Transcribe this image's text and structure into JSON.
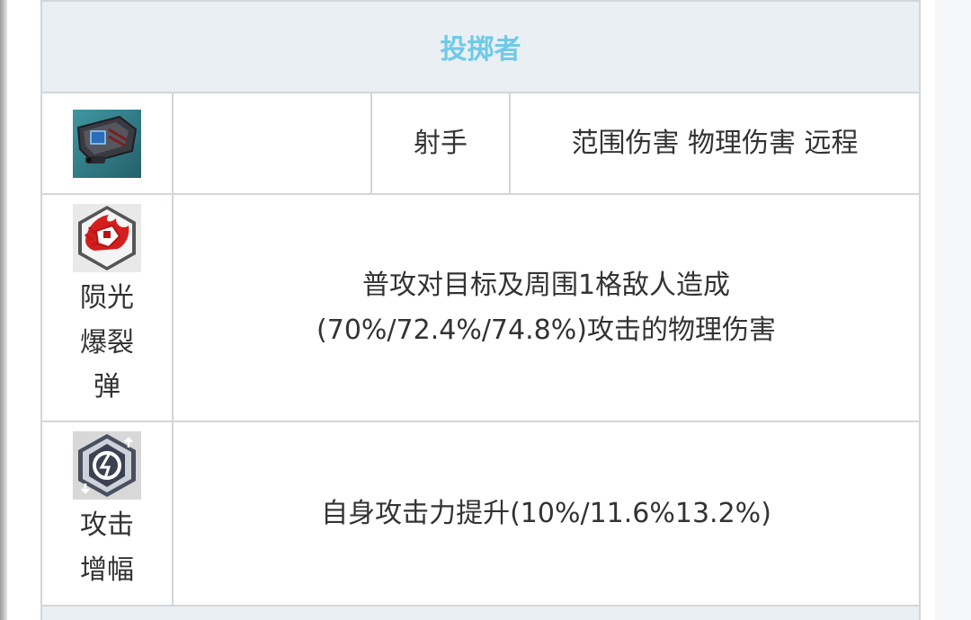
{
  "header": {
    "title": "投掷者"
  },
  "unit_row": {
    "icon": "turret-icon",
    "blank": "",
    "class_label": "射手",
    "tags": "范围伤害 物理伤害 远程"
  },
  "skills": [
    {
      "icon": "explosion-icon",
      "name": "陨光爆裂弹",
      "description_line1": "普攻对目标及周围1格敌人造成",
      "description_line2": "(70%/72.4%/74.8%)攻击的物理伤害"
    },
    {
      "icon": "attack-boost-icon",
      "name": "攻击增幅",
      "description_line1": "自身攻击力提升(10%/11.6%13.2%)"
    }
  ],
  "colors": {
    "header_text": "#6fcae8",
    "header_bg": "#eaeff4",
    "border": "#d3d6da",
    "body_text": "#333333"
  }
}
